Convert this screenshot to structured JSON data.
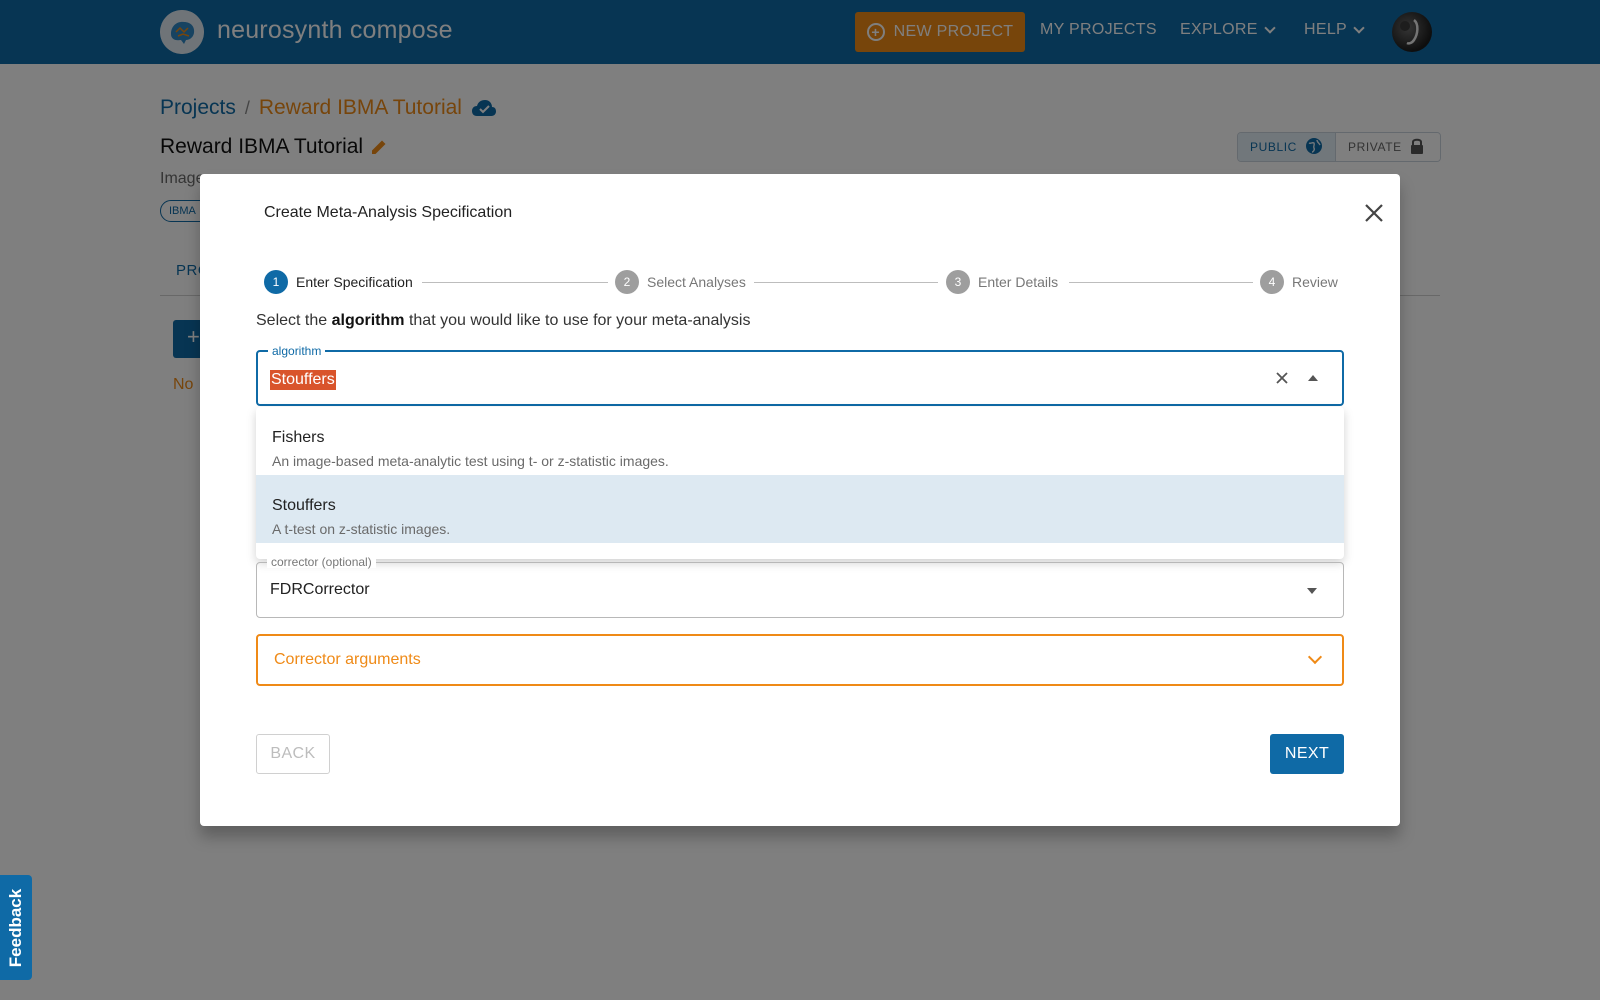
{
  "nav": {
    "brand": "neurosynth compose",
    "new_project": "NEW PROJECT",
    "my_projects": "MY PROJECTS",
    "explore": "EXPLORE",
    "help": "HELP"
  },
  "page": {
    "breadcrumb_root": "Projects",
    "breadcrumb_separator": "/",
    "breadcrumb_current": "Reward IBMA Tutorial",
    "title": "Reward IBMA Tutorial",
    "description": "Image",
    "tag": "IBMA",
    "tab": "PRO",
    "add_button": "+",
    "empty_text": "No",
    "visibility": {
      "public": "PUBLIC",
      "private": "PRIVATE"
    }
  },
  "modal": {
    "title": "Create Meta-Analysis Specification",
    "steps": [
      {
        "num": "1",
        "label": "Enter Specification",
        "active": true
      },
      {
        "num": "2",
        "label": "Select Analyses",
        "active": false
      },
      {
        "num": "3",
        "label": "Enter Details",
        "active": false
      },
      {
        "num": "4",
        "label": "Review",
        "active": false
      }
    ],
    "instruction_prefix": "Select the",
    "instruction_bold": "algorithm",
    "instruction_suffix": "that you would like to use for your meta-analysis",
    "algorithm": {
      "label": "algorithm",
      "value": "Stouffers",
      "options": [
        {
          "name": "Fishers",
          "description": "An image-based meta-analytic test using t- or z-statistic images.",
          "selected": false
        },
        {
          "name": "Stouffers",
          "description": "A t-test on z-statistic images.",
          "selected": true
        }
      ]
    },
    "corrector": {
      "label": "corrector (optional)",
      "value": "FDRCorrector"
    },
    "corrector_arguments": "Corrector arguments",
    "back": "BACK",
    "next": "NEXT"
  },
  "feedback": "Feedback",
  "colors": {
    "primary": "#0f6aa6",
    "accent": "#ef8a17",
    "selection_highlight": "#d9542b"
  }
}
